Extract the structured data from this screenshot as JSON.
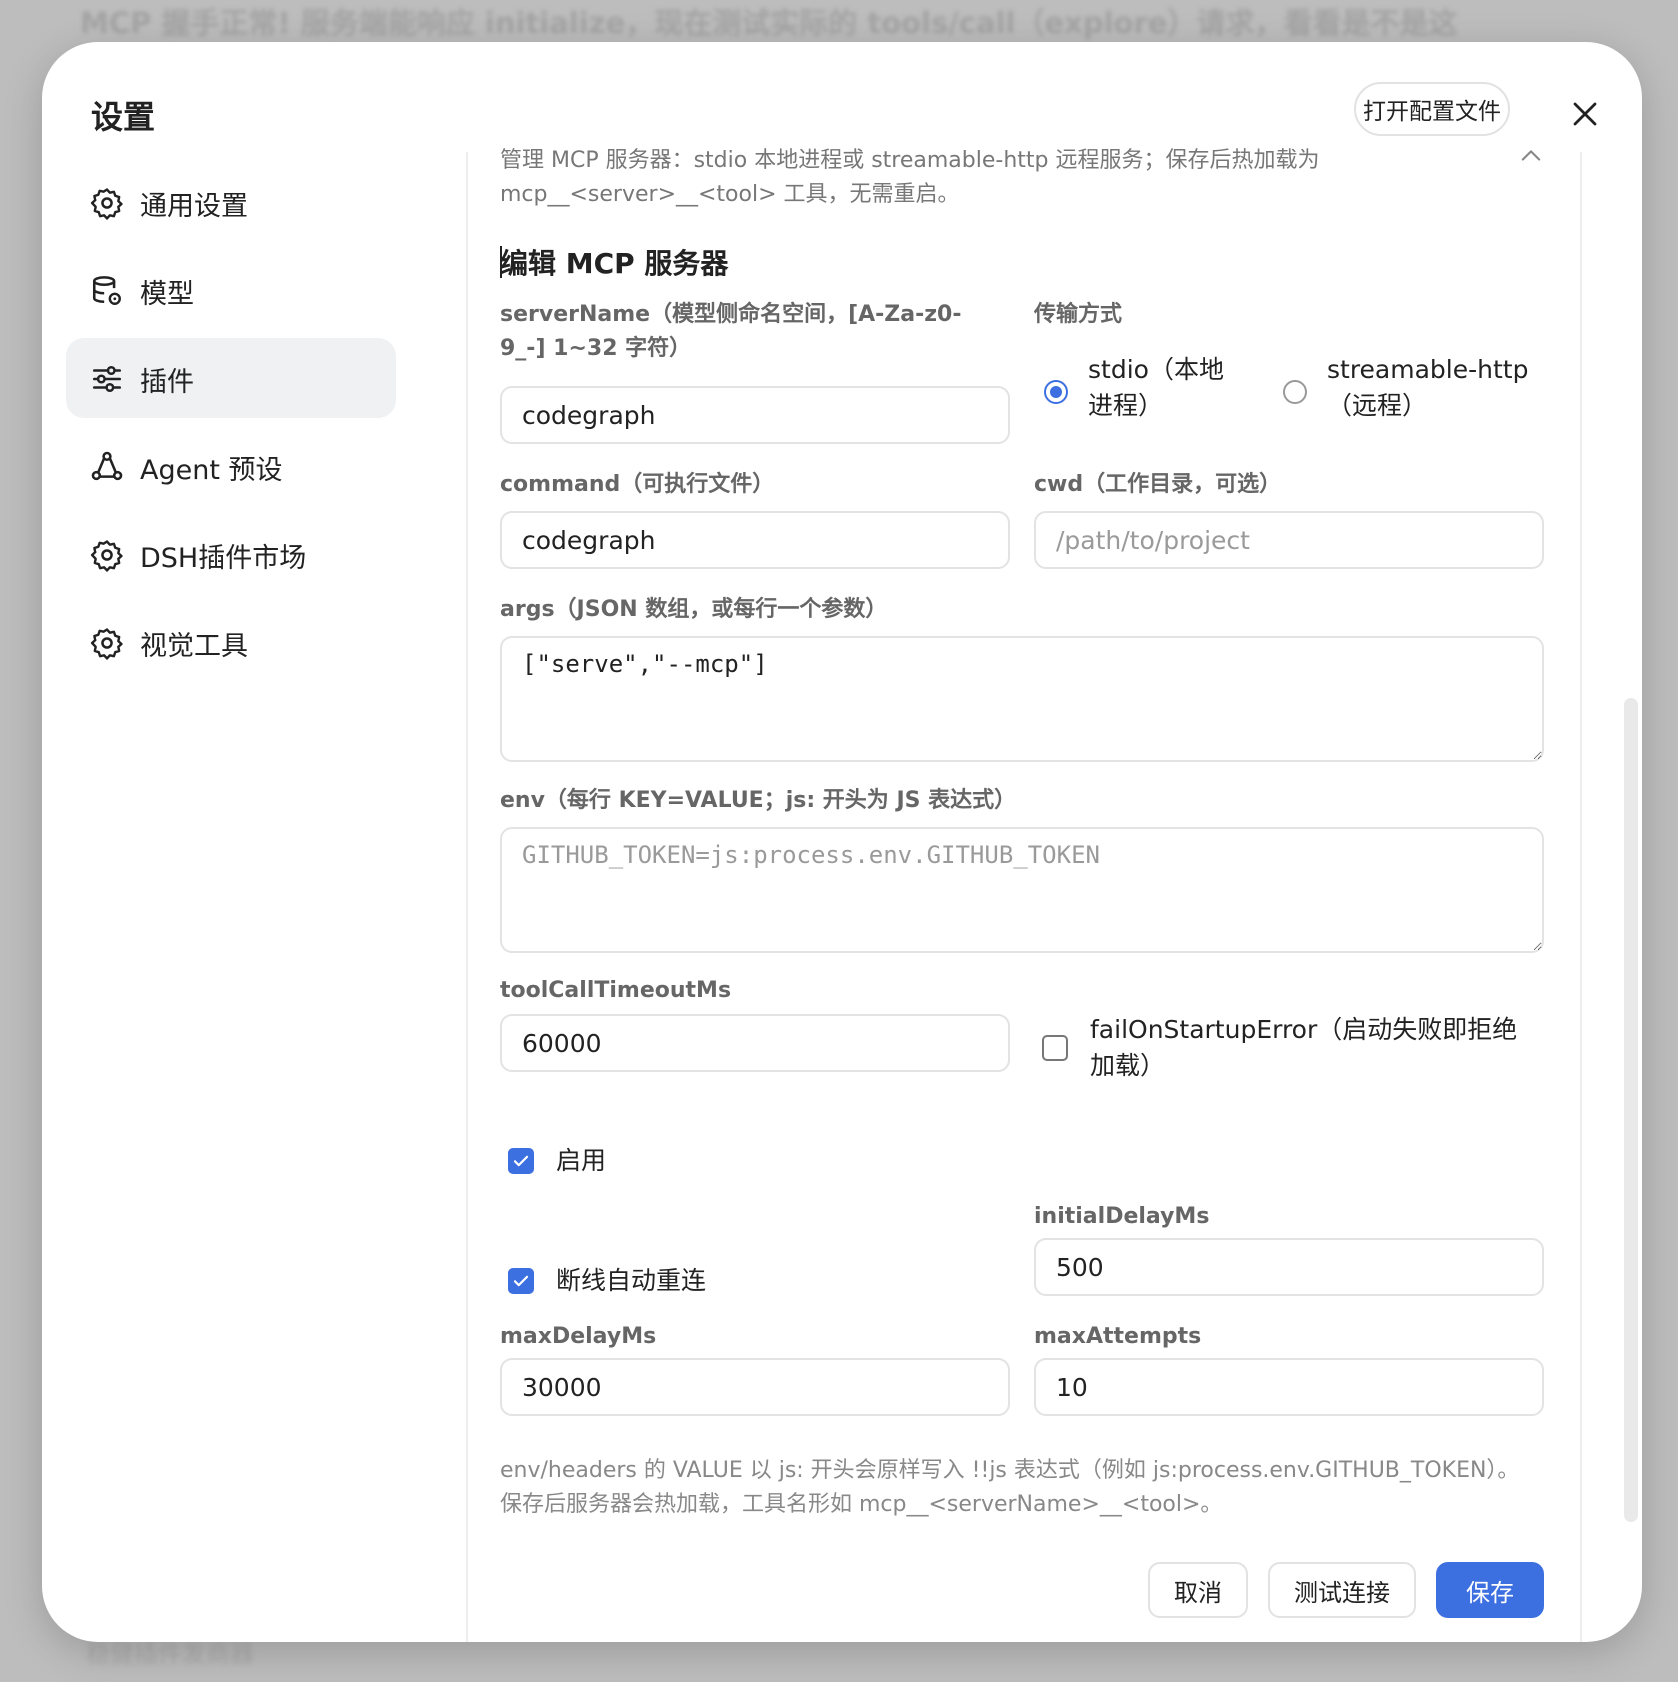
{
  "background": {
    "top_text": "MCP 握手正常! 服务端能响应 initialize，现在测试实际的 tools/call（explore）请求，看看是不是这",
    "bottom_text": "稳健插件发商器"
  },
  "modal": {
    "title": "设置",
    "open_config_label": "打开配置文件"
  },
  "nav": {
    "items": [
      {
        "label": "通用设置",
        "icon": "gear-icon"
      },
      {
        "label": "模型",
        "icon": "database-gear-icon"
      },
      {
        "label": "插件",
        "icon": "sliders-icon"
      },
      {
        "label": "Agent 预设",
        "icon": "network-icon"
      },
      {
        "label": "DSH插件市场",
        "icon": "gear-icon"
      },
      {
        "label": "视觉工具",
        "icon": "gear-icon"
      }
    ],
    "active_index": 2
  },
  "plugin": {
    "intro_line1": "管理 MCP 服务器：stdio 本地进程或 streamable-http 远程服务；保存后热加载为",
    "intro_line2": "mcp__<server>__<tool> 工具，无需重启。",
    "section_title": "编辑 MCP 服务器",
    "form": {
      "server_name_label_line1": "serverName（模型侧命名空间，[A-Za-z0-",
      "server_name_label_line2": "9_-] 1~32 字符）",
      "server_name_value": "codegraph",
      "transport_label": "传输方式",
      "transport_stdio_line1": "stdio（本地",
      "transport_stdio_line2": "进程）",
      "transport_http_line1": "streamable-http",
      "transport_http_line2": "（远程）",
      "transport_selected": "stdio",
      "command_label": "command（可执行文件）",
      "command_value": "codegraph",
      "cwd_label": "cwd（工作目录，可选）",
      "cwd_placeholder": "/path/to/project",
      "args_label": "args（JSON 数组，或每行一个参数）",
      "args_value": "[\"serve\",\"--mcp\"]",
      "env_label": "env（每行 KEY=VALUE；js: 开头为 JS 表达式）",
      "env_placeholder": "GITHUB_TOKEN=js:process.env.GITHUB_TOKEN",
      "timeout_label": "toolCallTimeoutMs",
      "timeout_value": "60000",
      "fail_on_startup_line1": "failOnStartupError（启动失败即拒绝",
      "fail_on_startup_line2": "加载）",
      "fail_on_startup_checked": false,
      "enabled_label": "启用",
      "enabled_checked": true,
      "initial_delay_label": "initialDelayMs",
      "initial_delay_value": "500",
      "auto_reconnect_label": "断线自动重连",
      "auto_reconnect_checked": true,
      "max_delay_label": "maxDelayMs",
      "max_delay_value": "30000",
      "max_attempts_label": "maxAttempts",
      "max_attempts_value": "10"
    },
    "footnote_line1": "env/headers 的 VALUE 以 js: 开头会原样写入 !!js 表达式（例如 js:process.env.GITHUB_TOKEN）。",
    "footnote_line2": "保存后服务器会热加载，工具名形如 mcp__<serverName>__<tool>。",
    "buttons": {
      "cancel": "取消",
      "test": "测试连接",
      "save": "保存"
    }
  },
  "colors": {
    "accent": "#3c6fe0",
    "active_nav_bg": "#f0f1f3",
    "backdrop": "#bdbdbd"
  }
}
